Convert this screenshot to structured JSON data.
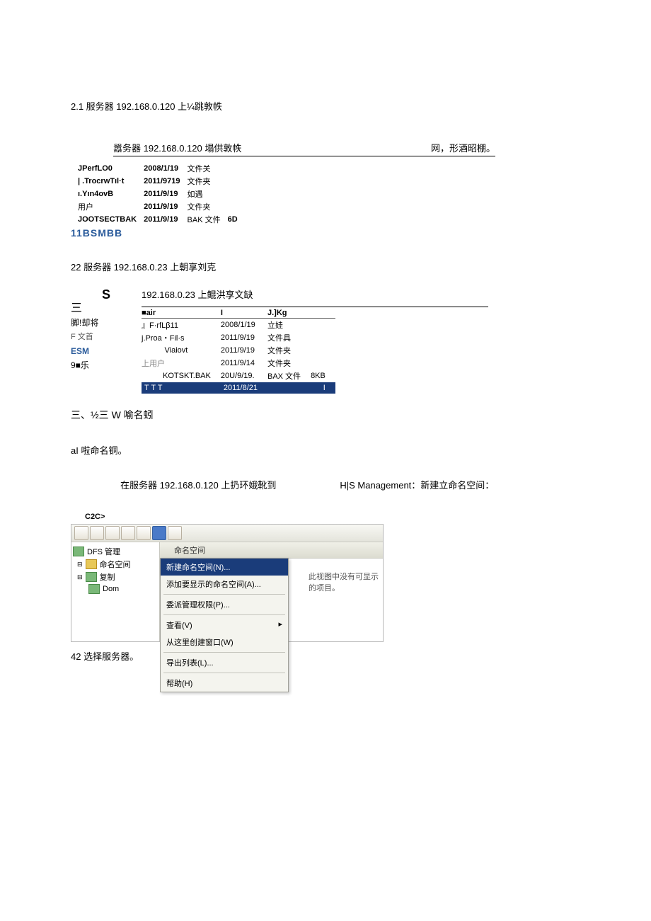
{
  "section21": {
    "title": "2.1 服务器 192.168.0.120 上¼跳敦帙",
    "caption_left": "嚣务器 192.168.0.120 塌供敦帙",
    "caption_right": "网，形酒昭棚。",
    "rows": [
      {
        "name": "JPerfLO0",
        "date": "2008/1/19",
        "type": "文件关",
        "size": ""
      },
      {
        "name": "| .TrocrwTıl·t",
        "date": "2011/9719",
        "type": "文件夹",
        "size": ""
      },
      {
        "name": "ı.Yın4ovB",
        "date": "2011/9/19",
        "type": "如遇",
        "size": ""
      },
      {
        "name": "用户",
        "date": "2011/9/19",
        "type": "文件夹",
        "size": ""
      },
      {
        "name": "JOOTSECTBAK",
        "date": "2011/9/19",
        "type": "BAK 文件",
        "size": "6D"
      }
    ],
    "footer": "11BSMBB"
  },
  "section22": {
    "title": "22 服务器 192.168.0.23 上朝享刘克",
    "caption": "192.168.0.23 上鲲洪享文缺",
    "left": {
      "s": "S",
      "san": "三",
      "l1": "脚!却将",
      "l2": "F 文首",
      "l3": "ESM",
      "l4": "9■乐"
    },
    "header": {
      "c1": "■air",
      "c2": "I",
      "c3": "J.]Kg"
    },
    "rows": [
      {
        "name": "』F·rfLβ11",
        "date": "2008/1/19",
        "type": "立娃",
        "size": ""
      },
      {
        "name": "j.Proa・Fil·s",
        "date": "2011/9/19",
        "type": "文件具",
        "size": ""
      },
      {
        "name": "Viaiovt",
        "date": "2011/9/19",
        "type": "文件夹",
        "size": ""
      },
      {
        "name": "上用户",
        "date": "2011/9/14",
        "type": "文件夹",
        "size": ""
      },
      {
        "name": "KOTSKT.BAK",
        "date": "20U/9/19.",
        "type": "BAX 文件",
        "size": "8KB"
      }
    ],
    "highlight": {
      "name": "T  T  T",
      "date": "2011/8/21",
      "type": "",
      "size": "I"
    }
  },
  "section3": {
    "heading": "三、½三 W 喻名蚓",
    "sub_a": "aI 啦命名铜。",
    "line": "在服务器  192.168.0.120 上扔环娥靴到",
    "line_right": "H|S Management：新建立命名空间：",
    "c2c": "C2C>"
  },
  "mmc": {
    "tree": {
      "root": "DFS 管理",
      "n1": "命名空间",
      "n2": "复制",
      "n3": "Dom"
    },
    "col_header": "命名空间",
    "menu": {
      "m1": "新建命名空间(N)...",
      "m2": "添加要显示的命名空间(A)...",
      "m3": "委派管理权限(P)...",
      "m4": "查看(V)",
      "m5": "从这里创建窗口(W)",
      "m6": "导出列表(L)...",
      "m7": "帮助(H)"
    },
    "empty": "此视图中没有可显示的项目。"
  },
  "final": "42 选择服务器。"
}
